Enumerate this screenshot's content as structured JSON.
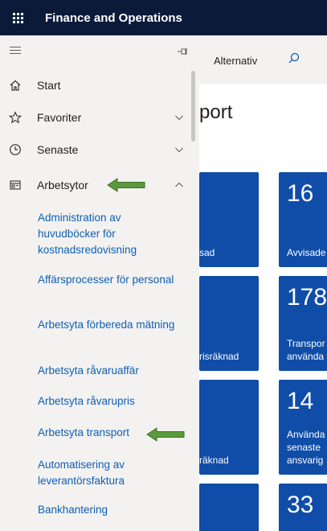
{
  "app": {
    "title": "Finance and Operations"
  },
  "nav": {
    "items": [
      {
        "label": "Start",
        "icon": "home-icon"
      },
      {
        "label": "Favoriter",
        "icon": "star-icon"
      },
      {
        "label": "Senaste",
        "icon": "clock-icon"
      },
      {
        "label": "Arbetsytor",
        "icon": "workspace-icon"
      }
    ],
    "workspaces": [
      {
        "label": "Administration av huvudböcker för kostnadsredovisning"
      },
      {
        "label": "Affärsprocesser för personal"
      },
      {
        "label": "Arbetsyta förbereda mätning"
      },
      {
        "label": "Arbetsyta råvaruaffär"
      },
      {
        "label": "Arbetsyta råvarupris"
      },
      {
        "label": "Arbetsyta transport"
      },
      {
        "label": "Automatisering av leverantörsfaktura"
      },
      {
        "label": "Bankhantering"
      }
    ]
  },
  "main": {
    "action": "Alternativ",
    "page_title": "port",
    "tiles": [
      {
        "label": "sad"
      },
      {
        "number": "16",
        "label": "Avvisade"
      },
      {
        "label": "risräknad"
      },
      {
        "number": "178",
        "label": "Transpor\nanvända"
      },
      {
        "label": "räknad"
      },
      {
        "number": "14",
        "label": "Använda\nsenaste\nansvarig"
      },
      {
        "number": "33"
      }
    ]
  },
  "colors": {
    "topbar": "#0c1a3a",
    "nav_bg": "#f3f2f1",
    "link": "#0f5fb3",
    "tile": "#0f4da8",
    "arrow": "#5a9a3c"
  }
}
